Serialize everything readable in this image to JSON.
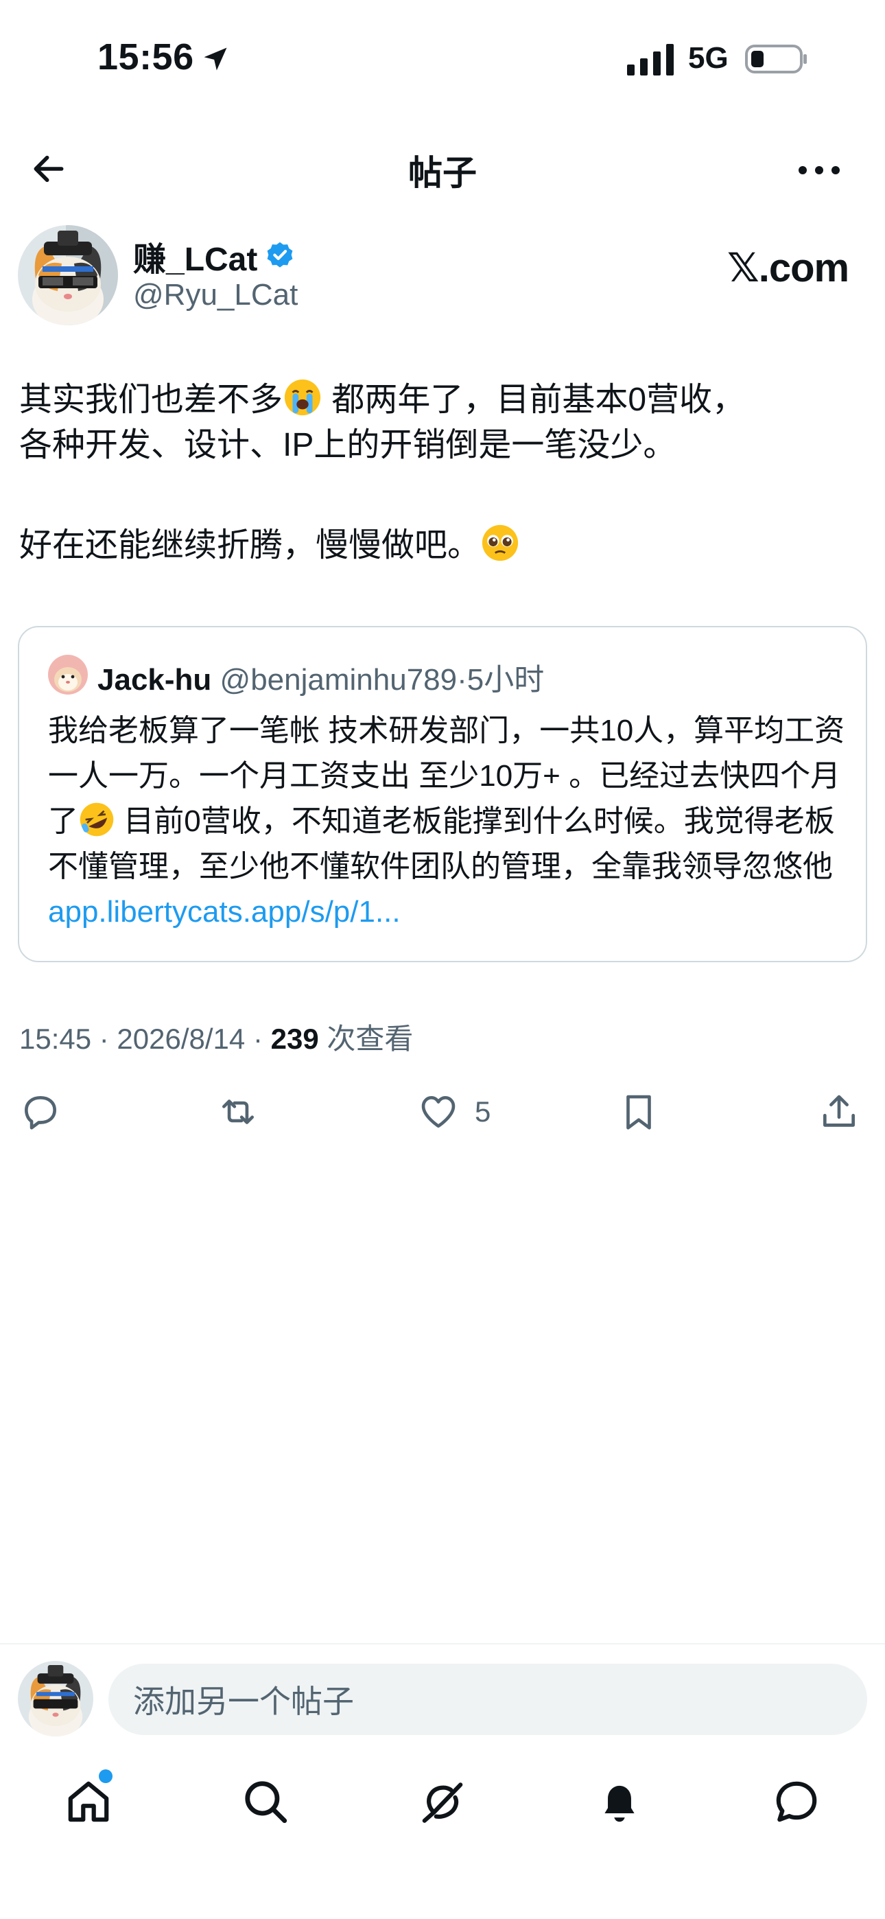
{
  "status_bar": {
    "time": "15:56",
    "network": "5G"
  },
  "nav": {
    "title": "帖子"
  },
  "author": {
    "name": "赚_LCat",
    "handle": "@Ryu_LCat",
    "source": "𝕏.com"
  },
  "post": {
    "line1": "其实我们也差不多",
    "line1b": " 都两年了，目前基本0营收，",
    "line2": "各种开发、设计、IP上的开销倒是一笔没少。",
    "line3": "好在还能继续折腾，慢慢做吧。"
  },
  "quote": {
    "name": "Jack-hu",
    "handle": "@benjaminhu789",
    "sep": "·",
    "time": "5小时",
    "text_a": "我给老板算了一笔帐 技术研发部门，一共10人，算平均工资一人一万。一个月工资支出 至少10万+ 。已经过去快四个月了",
    "text_b": " 目前0营收，不知道老板能撑到什么时候。我觉得老板不懂管理，至少他不懂软件团队的管理，全靠我领导忽悠他 ",
    "link": "app.libertycats.app/s/p/1..."
  },
  "meta": {
    "time": "15:45 · 2026/8/14 · ",
    "views": "239",
    "views_label": " 次查看"
  },
  "actions": {
    "likes": "5"
  },
  "reply": {
    "placeholder": "添加另一个帖子"
  },
  "colors": {
    "accent": "#1d9bf0",
    "text": "#0f1419",
    "secondary": "#536471",
    "border": "#cfd9de"
  }
}
